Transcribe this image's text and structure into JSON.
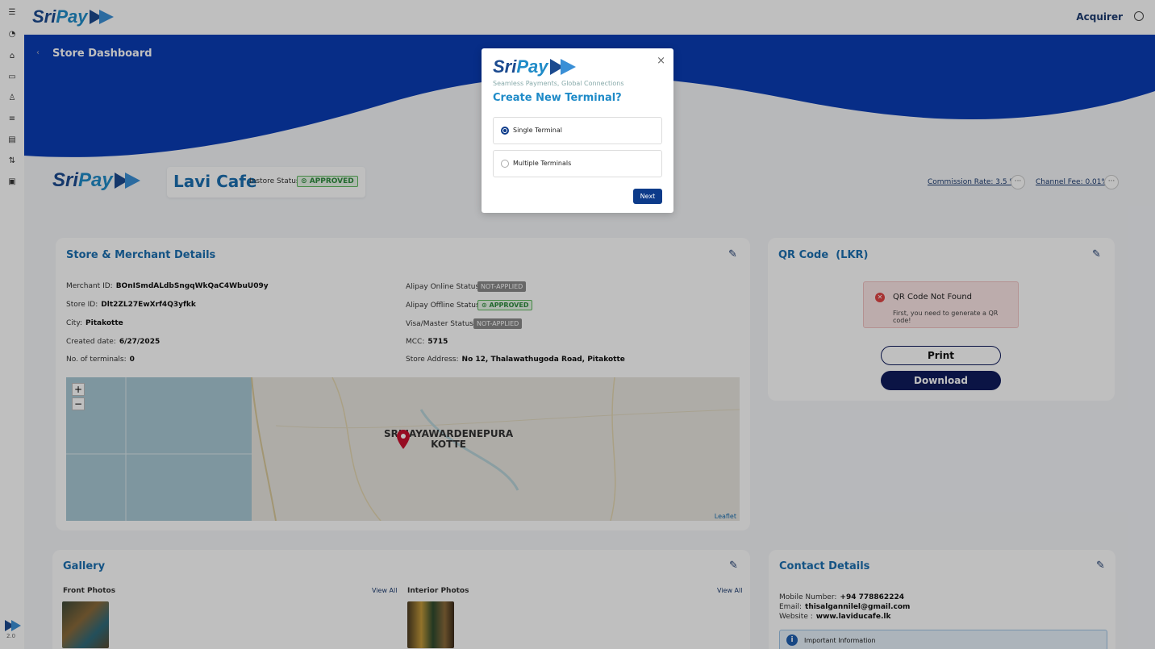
{
  "brand": {
    "name_a": "Sri",
    "name_b": "Pay",
    "tagline": "Seamless Payments, Global Connections",
    "version": "2.0"
  },
  "header": {
    "user_label": "Acquirer"
  },
  "page": {
    "title": "Store Dashboard"
  },
  "store": {
    "name": "Lavi Cafe",
    "instore_label": "Instore Status:",
    "instore_status": "APPROVED",
    "commission": "Commission Rate: 3.5 %",
    "channel_fee": "Channel Fee: 0.01%"
  },
  "details": {
    "title": "Store & Merchant Details",
    "merchant_id_label": "Merchant ID:",
    "merchant_id": "BOnISmdALdbSngqWkQaC4WbuU09y",
    "store_id_label": "Store ID:",
    "store_id": "Dlt2ZL27EwXrf4Q3yfkk",
    "city_label": "City:",
    "city": "Pitakotte",
    "created_label": "Created date:",
    "created": "6/27/2025",
    "terminals_label": "No. of terminals:",
    "terminals": "0",
    "alipay_online_label": "Alipay Online Status:",
    "alipay_online": "NOT-APPLIED",
    "alipay_offline_label": "Alipay Offline Status:",
    "alipay_offline": "APPROVED",
    "visa_label": "Visa/Master Status:",
    "visa": "NOT-APPLIED",
    "mcc_label": "MCC:",
    "mcc": "5715",
    "address_label": "Store Address:",
    "address": "No 12, Thalawathugoda Road, Pitakotte"
  },
  "map": {
    "city_line1": "SRI JAYAWARDENEPURA",
    "city_line2": "KOTTE",
    "zoom_in": "+",
    "zoom_out": "−",
    "attribution": "Leaflet"
  },
  "qr": {
    "title": "QR Code  (LKR)",
    "alert_title": "QR Code Not Found",
    "alert_msg": "First, you need to generate a QR code!",
    "print": "Print",
    "download": "Download"
  },
  "gallery": {
    "title": "Gallery",
    "front": "Front Photos",
    "interior": "Interior Photos",
    "view_all": "View All"
  },
  "contact": {
    "title": "Contact Details",
    "mobile_label": "Mobile Number:",
    "mobile": "+94 778862224",
    "email_label": "Email:",
    "email": "thisalgannilel@gmail.com",
    "website_label": "Website :",
    "website": "www.laviducafe.lk",
    "info": "Important Information"
  },
  "modal": {
    "title": "Create New Terminal?",
    "option_single": "Single Terminal",
    "option_multiple": "Multiple Terminals",
    "selected": "Single Terminal",
    "next": "Next",
    "close": "×"
  },
  "colors": {
    "primary": "#0d3b8a",
    "wave": "#0a3cb4",
    "accent": "#1f8bc8",
    "approved": "#2e8b3e",
    "error": "#e04545"
  }
}
